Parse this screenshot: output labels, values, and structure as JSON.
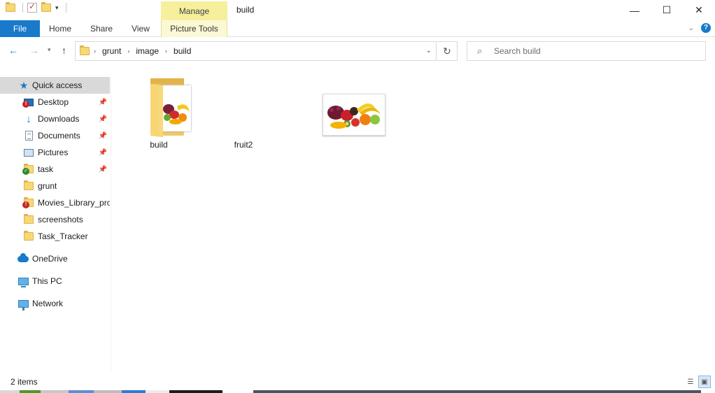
{
  "window": {
    "title": "build",
    "contextual_tab_group": "Manage",
    "controls": {
      "minimize": "—",
      "maximize": "☐",
      "close": "✕"
    }
  },
  "ribbon": {
    "tabs": [
      {
        "label": "File",
        "active": true
      },
      {
        "label": "Home"
      },
      {
        "label": "Share"
      },
      {
        "label": "View"
      },
      {
        "label": "Picture Tools"
      }
    ],
    "help": "?"
  },
  "navigation": {
    "path": [
      "grunt",
      "image",
      "build"
    ],
    "search_placeholder": "Search build"
  },
  "sidebar": {
    "quick_access": "Quick access",
    "items": [
      {
        "label": "Desktop",
        "pinned": true,
        "icon": "desktop-icon"
      },
      {
        "label": "Downloads",
        "pinned": true,
        "icon": "download-icon"
      },
      {
        "label": "Documents",
        "pinned": true,
        "icon": "documents-icon"
      },
      {
        "label": "Pictures",
        "pinned": true,
        "icon": "pictures-icon"
      },
      {
        "label": "task",
        "pinned": true,
        "icon": "folder-icon"
      },
      {
        "label": "grunt",
        "pinned": false,
        "icon": "folder-icon"
      },
      {
        "label": "Movies_Library_pro",
        "pinned": false,
        "icon": "folder-icon"
      },
      {
        "label": "screenshots",
        "pinned": false,
        "icon": "folder-icon"
      },
      {
        "label": "Task_Tracker",
        "pinned": false,
        "icon": "folder-icon"
      }
    ],
    "locations": [
      {
        "label": "OneDrive",
        "icon": "onedrive-icon"
      },
      {
        "label": "This PC",
        "icon": "this-pc-icon"
      },
      {
        "label": "Network",
        "icon": "network-icon"
      }
    ]
  },
  "files": [
    {
      "name": "build",
      "type": "folder"
    },
    {
      "name": "fruit2",
      "type": "image"
    }
  ],
  "status": {
    "item_count": "2 items"
  },
  "colors": {
    "accent": "#1979ca",
    "manage_tab": "#f6ef9c",
    "selected_row": "#d9d9d9"
  }
}
